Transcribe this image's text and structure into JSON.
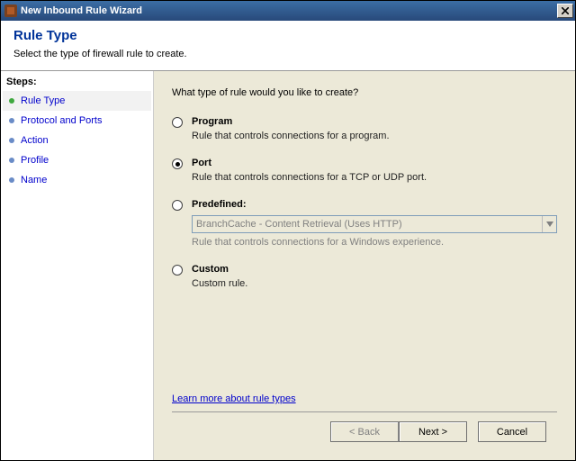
{
  "window": {
    "title": "New Inbound Rule Wizard"
  },
  "header": {
    "title": "Rule Type",
    "subtitle": "Select the type of firewall rule to create."
  },
  "sidebar": {
    "heading": "Steps:",
    "items": [
      {
        "label": "Rule Type"
      },
      {
        "label": "Protocol and Ports"
      },
      {
        "label": "Action"
      },
      {
        "label": "Profile"
      },
      {
        "label": "Name"
      }
    ]
  },
  "content": {
    "question": "What type of rule would you like to create?",
    "options": {
      "program": {
        "label": "Program",
        "desc": "Rule that controls connections for a program."
      },
      "port": {
        "label": "Port",
        "desc": "Rule that controls connections for a TCP or UDP port."
      },
      "predefined": {
        "label": "Predefined:",
        "selectValue": "BranchCache - Content Retrieval (Uses HTTP)",
        "desc": "Rule that controls connections for a Windows experience."
      },
      "custom": {
        "label": "Custom",
        "desc": "Custom rule."
      }
    },
    "learnMore": "Learn more about rule types"
  },
  "buttons": {
    "back": "< Back",
    "next": "Next >",
    "cancel": "Cancel"
  }
}
